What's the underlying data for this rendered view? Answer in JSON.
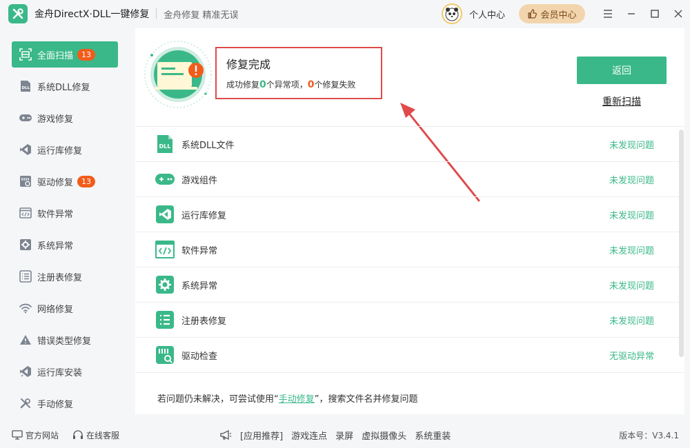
{
  "app": {
    "title": "金舟DirectX·DLL一键修复",
    "slogan": "金舟修复 精准无误"
  },
  "header": {
    "user_center": "个人中心",
    "vip_center": "会员中心"
  },
  "sidebar": {
    "items": [
      {
        "label": "全面扫描",
        "badge": "13",
        "icon": "scan-icon",
        "active": true
      },
      {
        "label": "系统DLL修复",
        "icon": "dll-icon"
      },
      {
        "label": "游戏修复",
        "icon": "gamepad-icon"
      },
      {
        "label": "运行库修复",
        "icon": "runtime-icon"
      },
      {
        "label": "驱动修复",
        "badge": "13",
        "icon": "driver-icon"
      },
      {
        "label": "软件异常",
        "icon": "code-window-icon"
      },
      {
        "label": "系统异常",
        "icon": "gear-icon"
      },
      {
        "label": "注册表修复",
        "icon": "list-icon"
      },
      {
        "label": "网络修复",
        "icon": "wifi-icon"
      },
      {
        "label": "错误类型修复",
        "icon": "warning-icon"
      },
      {
        "label": "运行库安装",
        "icon": "runtime-install-icon"
      },
      {
        "label": "手动修复",
        "icon": "wrench-icon"
      }
    ]
  },
  "result": {
    "title": "修复完成",
    "prefix": "成功修复",
    "fixed_count": "0",
    "mid": "个异常项，",
    "failed_count": "0",
    "suffix": "个修复失败"
  },
  "actions": {
    "back": "返回",
    "rescan": "重新扫描"
  },
  "list": {
    "rows": [
      {
        "label": "系统DLL文件",
        "status": "未发现问题",
        "icon": "dll-file-icon"
      },
      {
        "label": "游戏组件",
        "status": "未发现问题",
        "icon": "gamepad-icon"
      },
      {
        "label": "运行库修复",
        "status": "未发现问题",
        "icon": "visual-studio-icon"
      },
      {
        "label": "软件异常",
        "status": "未发现问题",
        "icon": "code-window-icon"
      },
      {
        "label": "系统异常",
        "status": "未发现问题",
        "icon": "gear-icon"
      },
      {
        "label": "注册表修复",
        "status": "未发现问题",
        "icon": "list-icon"
      },
      {
        "label": "驱动检查",
        "status": "无驱动异常",
        "icon": "driver-icon"
      }
    ]
  },
  "hint": {
    "before": "若问题仍未解决，可尝试使用“",
    "link": "手动修复",
    "after": "”，搜索文件名并修复问题"
  },
  "footer": {
    "website": "官方网站",
    "service": "在线客服",
    "recommend": "[应用推荐]",
    "apps": [
      "游戏连点",
      "录屏",
      "虚拟摄像头",
      "系统重装"
    ],
    "version": "版本号：V3.4.1"
  },
  "colors": {
    "accent": "#3ab889",
    "badge": "#f25c1a",
    "highlight_border": "#e04a4a",
    "vip": "#f3d5ad"
  }
}
